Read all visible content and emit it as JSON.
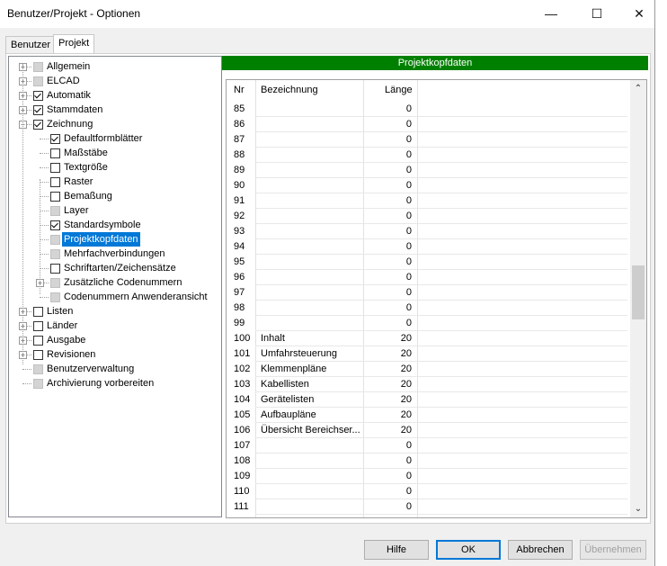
{
  "window": {
    "title": "Benutzer/Projekt - Optionen",
    "minimize": "—",
    "maximize": "☐",
    "close": "✕"
  },
  "tabs": [
    {
      "label": "Benutzer"
    },
    {
      "label": "Projekt"
    }
  ],
  "tree": [
    {
      "label": "Allgemein",
      "check": "gray",
      "expander": "+",
      "level": 0
    },
    {
      "label": "ELCAD",
      "check": "gray",
      "expander": "+",
      "level": 0
    },
    {
      "label": "Automatik",
      "check": "checked",
      "expander": "+",
      "level": 0
    },
    {
      "label": "Stammdaten",
      "check": "checked",
      "expander": "+",
      "level": 0
    },
    {
      "label": "Zeichnung",
      "check": "checked",
      "expander": "−",
      "level": 0
    },
    {
      "label": "Defaultformblätter",
      "check": "checked",
      "level": 1
    },
    {
      "label": "Maßstäbe",
      "check": "empty",
      "level": 1
    },
    {
      "label": "Textgröße",
      "check": "empty",
      "level": 1
    },
    {
      "label": "Raster",
      "check": "empty",
      "level": 1
    },
    {
      "label": "Bemaßung",
      "check": "empty",
      "level": 1
    },
    {
      "label": "Layer",
      "check": "gray",
      "level": 1
    },
    {
      "label": "Standardsymbole",
      "check": "checked",
      "level": 1
    },
    {
      "label": "Projektkopfdaten",
      "check": "gray",
      "level": 1,
      "selected": true
    },
    {
      "label": "Mehrfachverbindungen",
      "check": "gray",
      "level": 1
    },
    {
      "label": "Schriftarten/Zeichensätze",
      "check": "empty",
      "level": 1
    },
    {
      "label": "Zusätzliche Codenummern",
      "check": "gray",
      "expander": "+",
      "level": 1
    },
    {
      "label": "Codenummern Anwenderansicht",
      "check": "gray",
      "level": 1
    },
    {
      "label": "Listen",
      "check": "empty",
      "expander": "+",
      "level": 0
    },
    {
      "label": "Länder",
      "check": "empty",
      "expander": "+",
      "level": 0
    },
    {
      "label": "Ausgabe",
      "check": "empty",
      "expander": "+",
      "level": 0
    },
    {
      "label": "Revisionen",
      "check": "empty",
      "expander": "+",
      "level": 0
    },
    {
      "label": "Benutzerverwaltung",
      "check": "gray",
      "level": 0
    },
    {
      "label": "Archivierung vorbereiten",
      "check": "gray",
      "level": 0
    }
  ],
  "panel": {
    "header": "Projektkopfdaten"
  },
  "table": {
    "columns": [
      "Nr",
      "Bezeichnung",
      "Länge"
    ],
    "rows": [
      [
        "85",
        "",
        "0"
      ],
      [
        "86",
        "",
        "0"
      ],
      [
        "87",
        "",
        "0"
      ],
      [
        "88",
        "",
        "0"
      ],
      [
        "89",
        "",
        "0"
      ],
      [
        "90",
        "",
        "0"
      ],
      [
        "91",
        "",
        "0"
      ],
      [
        "92",
        "",
        "0"
      ],
      [
        "93",
        "",
        "0"
      ],
      [
        "94",
        "",
        "0"
      ],
      [
        "95",
        "",
        "0"
      ],
      [
        "96",
        "",
        "0"
      ],
      [
        "97",
        "",
        "0"
      ],
      [
        "98",
        "",
        "0"
      ],
      [
        "99",
        "",
        "0"
      ],
      [
        "100",
        "Inhalt",
        "20"
      ],
      [
        "101",
        "Umfahrsteuerung",
        "20"
      ],
      [
        "102",
        "Klemmenpläne",
        "20"
      ],
      [
        "103",
        "Kabellisten",
        "20"
      ],
      [
        "104",
        "Gerätelisten",
        "20"
      ],
      [
        "105",
        "Aufbaupläne",
        "20"
      ],
      [
        "106",
        "Übersicht Bereichser...",
        "20"
      ],
      [
        "107",
        "",
        "0"
      ],
      [
        "108",
        "",
        "0"
      ],
      [
        "109",
        "",
        "0"
      ],
      [
        "110",
        "",
        "0"
      ],
      [
        "111",
        "",
        "0"
      ]
    ]
  },
  "buttons": {
    "help": "Hilfe",
    "ok": "OK",
    "cancel": "Abbrechen",
    "apply": "Übernehmen"
  },
  "colors": {
    "header_bg": "#008000",
    "selection": "#0078d7"
  }
}
